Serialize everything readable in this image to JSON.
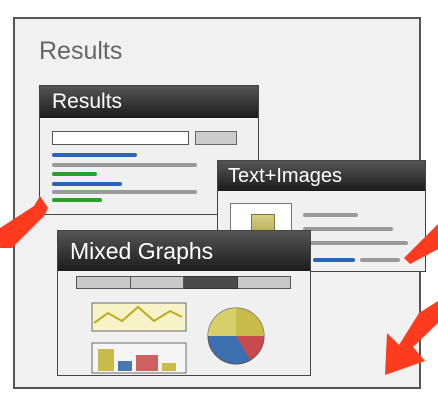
{
  "panel": {
    "title": "Results"
  },
  "windows": {
    "results": {
      "title": "Results"
    },
    "text_images": {
      "title": "Text+Images"
    },
    "mixed_graphs": {
      "title": "Mixed Graphs"
    }
  },
  "colors": {
    "accent_blue": "#2b63b8",
    "accent_green": "#2aa02a",
    "arrow_red": "#ff3b1f",
    "title_bar": "#2a2a2a"
  }
}
